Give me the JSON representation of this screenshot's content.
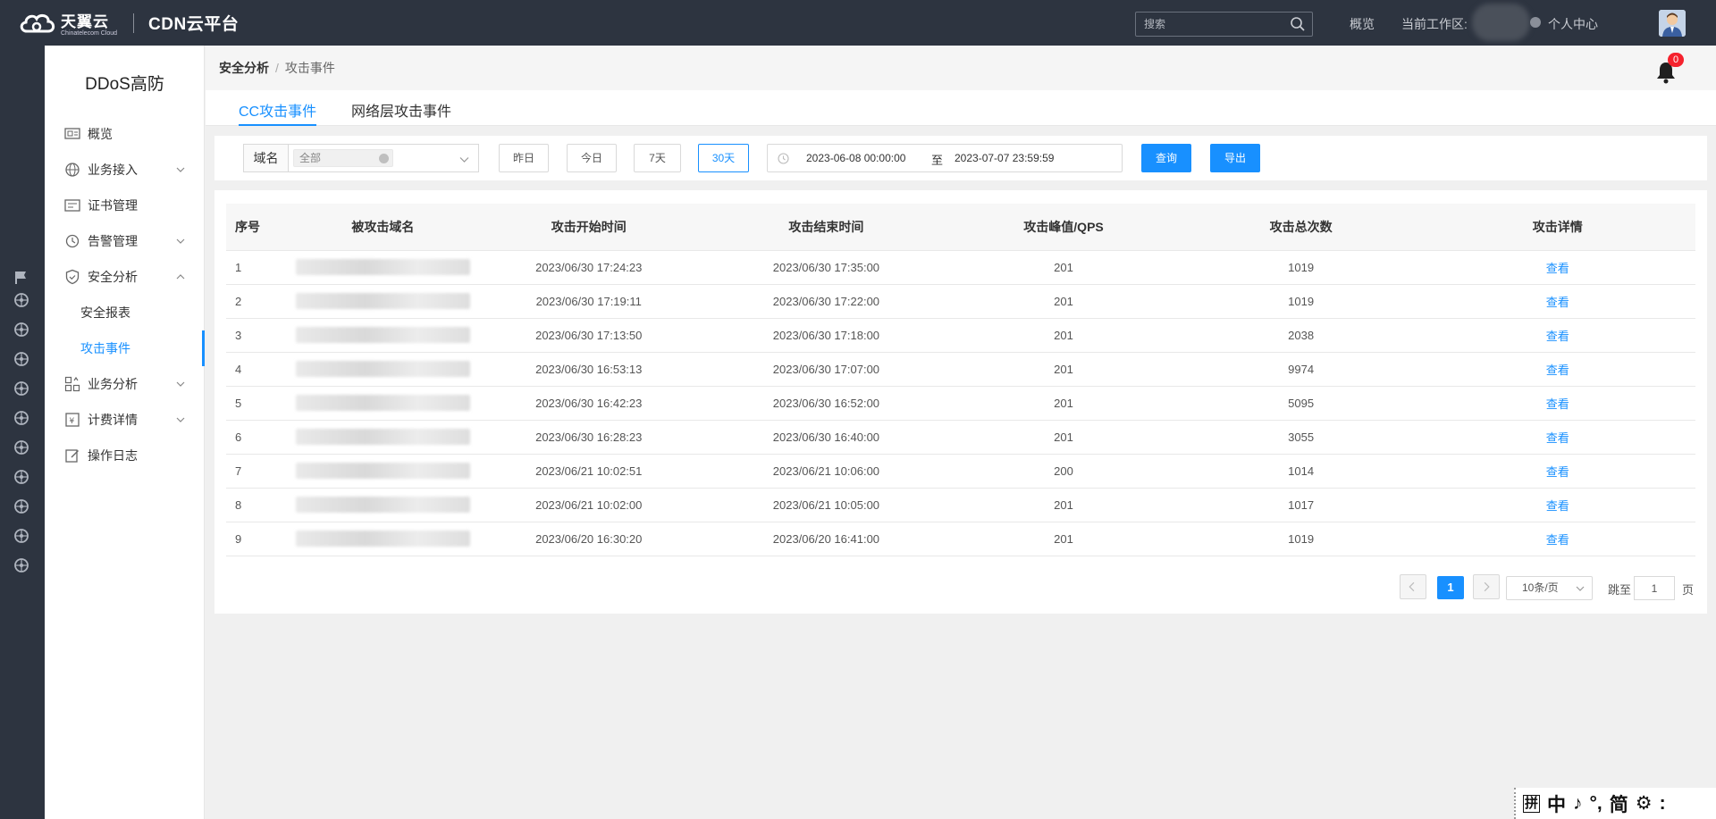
{
  "topbar": {
    "brand": "天翼云",
    "brand_sub": "Chinatelecom Cloud",
    "product": "CDN云平台",
    "search_placeholder": "搜索",
    "nav_overview": "概览",
    "nav_workspace": "当前工作区:",
    "nav_profile": "个人中心"
  },
  "sidebar": {
    "title": "DDoS高防",
    "items": [
      {
        "label": "概览",
        "icon": "overview-icon"
      },
      {
        "label": "业务接入",
        "icon": "globe-icon"
      },
      {
        "label": "证书管理",
        "icon": "certificate-icon"
      },
      {
        "label": "告警管理",
        "icon": "alarm-icon"
      },
      {
        "label": "安全分析",
        "icon": "shield-icon"
      },
      {
        "label": "业务分析",
        "icon": "chart-icon"
      },
      {
        "label": "计费详情",
        "icon": "billing-icon"
      },
      {
        "label": "操作日志",
        "icon": "log-icon"
      }
    ],
    "sub_items": [
      "安全报表",
      "攻击事件"
    ]
  },
  "breadcrumb": {
    "parent": "安全分析",
    "current": "攻击事件"
  },
  "notifications": {
    "count": "0"
  },
  "tabs": [
    "CC攻击事件",
    "网络层攻击事件"
  ],
  "filter": {
    "domain_label": "域名",
    "domain_value": "全部",
    "quick": [
      "昨日",
      "今日",
      "7天",
      "30天"
    ],
    "range_start": "2023-06-08 00:00:00",
    "range_to": "至",
    "range_end": "2023-07-07 23:59:59",
    "query_label": "查询",
    "export_label": "导出"
  },
  "table": {
    "headers": [
      "序号",
      "被攻击域名",
      "攻击开始时间",
      "攻击结束时间",
      "攻击峰值/QPS",
      "攻击总次数",
      "攻击详情"
    ],
    "link_label": "查看",
    "rows": [
      {
        "idx": "1",
        "start": "2023/06/30 17:24:23",
        "end": "2023/06/30 17:35:00",
        "peak": "201",
        "total": "1019"
      },
      {
        "idx": "2",
        "start": "2023/06/30 17:19:11",
        "end": "2023/06/30 17:22:00",
        "peak": "201",
        "total": "1019"
      },
      {
        "idx": "3",
        "start": "2023/06/30 17:13:50",
        "end": "2023/06/30 17:18:00",
        "peak": "201",
        "total": "2038"
      },
      {
        "idx": "4",
        "start": "2023/06/30 16:53:13",
        "end": "2023/06/30 17:07:00",
        "peak": "201",
        "total": "9974"
      },
      {
        "idx": "5",
        "start": "2023/06/30 16:42:23",
        "end": "2023/06/30 16:52:00",
        "peak": "201",
        "total": "5095"
      },
      {
        "idx": "6",
        "start": "2023/06/30 16:28:23",
        "end": "2023/06/30 16:40:00",
        "peak": "201",
        "total": "3055"
      },
      {
        "idx": "7",
        "start": "2023/06/21 10:02:51",
        "end": "2023/06/21 10:06:00",
        "peak": "200",
        "total": "1014"
      },
      {
        "idx": "8",
        "start": "2023/06/21 10:02:00",
        "end": "2023/06/21 10:05:00",
        "peak": "201",
        "total": "1017"
      },
      {
        "idx": "9",
        "start": "2023/06/20 16:30:20",
        "end": "2023/06/20 16:41:00",
        "peak": "201",
        "total": "1019"
      }
    ]
  },
  "pagination": {
    "current": "1",
    "page_size": "10条/页",
    "jump_label": "跳至",
    "jump_value": "1",
    "page_label": "页"
  },
  "ime": [
    "拼",
    "中",
    "♪",
    "°,",
    "简",
    "⚙",
    ":"
  ]
}
